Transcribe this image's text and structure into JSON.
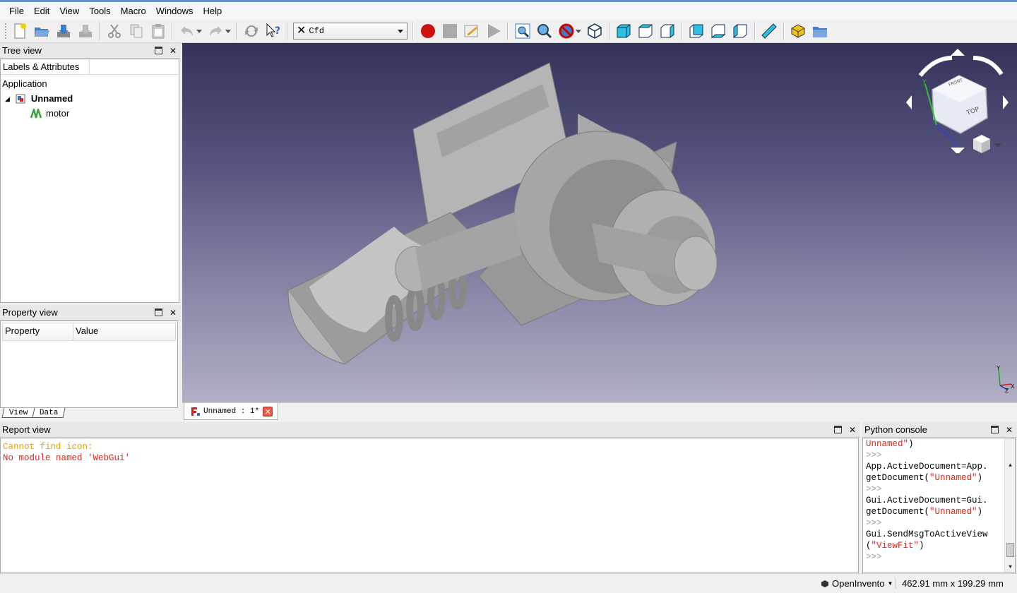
{
  "menu": [
    "File",
    "Edit",
    "View",
    "Tools",
    "Macro",
    "Windows",
    "Help"
  ],
  "workbench": {
    "label": "Cfd"
  },
  "tree_view": {
    "title": "Tree view",
    "columns": [
      "Labels & Attributes",
      ""
    ],
    "root": "Application",
    "document": "Unnamed",
    "object": "motor"
  },
  "property_view": {
    "title": "Property view",
    "columns": [
      "Property",
      "Value"
    ],
    "tabs": [
      "View",
      "Data"
    ]
  },
  "document_tab": {
    "label": "Unnamed : 1*"
  },
  "report_view": {
    "title": "Report view",
    "lines": [
      {
        "text": "Cannot find icon:",
        "color": "#e8a000"
      },
      {
        "text": "",
        "color": "#000000"
      },
      {
        "text": "No module named 'WebGui'",
        "color": "#e0261d"
      }
    ]
  },
  "python_console": {
    "title": "Python console",
    "lines": [
      [
        {
          "t": "Unnamed\"",
          "c": "str"
        },
        {
          "t": ")",
          "c": "code"
        }
      ],
      [
        {
          "t": ">>>",
          "c": "prompt"
        }
      ],
      [
        {
          "t": "App.ActiveDocument=App.",
          "c": "code"
        }
      ],
      [
        {
          "t": "getDocument(",
          "c": "code"
        },
        {
          "t": "\"Unnamed\"",
          "c": "str"
        },
        {
          "t": ")",
          "c": "code"
        }
      ],
      [
        {
          "t": ">>>",
          "c": "prompt"
        }
      ],
      [
        {
          "t": "Gui.ActiveDocument=Gui.",
          "c": "code"
        }
      ],
      [
        {
          "t": "getDocument(",
          "c": "code"
        },
        {
          "t": "\"Unnamed\"",
          "c": "str"
        },
        {
          "t": ")",
          "c": "code"
        }
      ],
      [
        {
          "t": ">>>",
          "c": "prompt"
        }
      ],
      [
        {
          "t": "Gui.SendMsgToActiveView",
          "c": "code"
        }
      ],
      [
        {
          "t": "(",
          "c": "code"
        },
        {
          "t": "\"ViewFit\"",
          "c": "str"
        },
        {
          "t": ")",
          "c": "code"
        }
      ],
      [
        {
          "t": ">>>",
          "c": "prompt"
        }
      ]
    ]
  },
  "statusbar": {
    "navigation_style": "OpenInvento",
    "dimensions": "462.91 mm x 199.29 mm"
  },
  "navcube": {
    "face_top": "TOP",
    "face_front": "FRONT",
    "axis_x": "X",
    "axis_y": "Y",
    "axis_z": "Z"
  },
  "colors": {
    "model": "#a8a8a8",
    "accent": "#6b93c9",
    "error": "#e0261d",
    "warning": "#e8a000"
  }
}
